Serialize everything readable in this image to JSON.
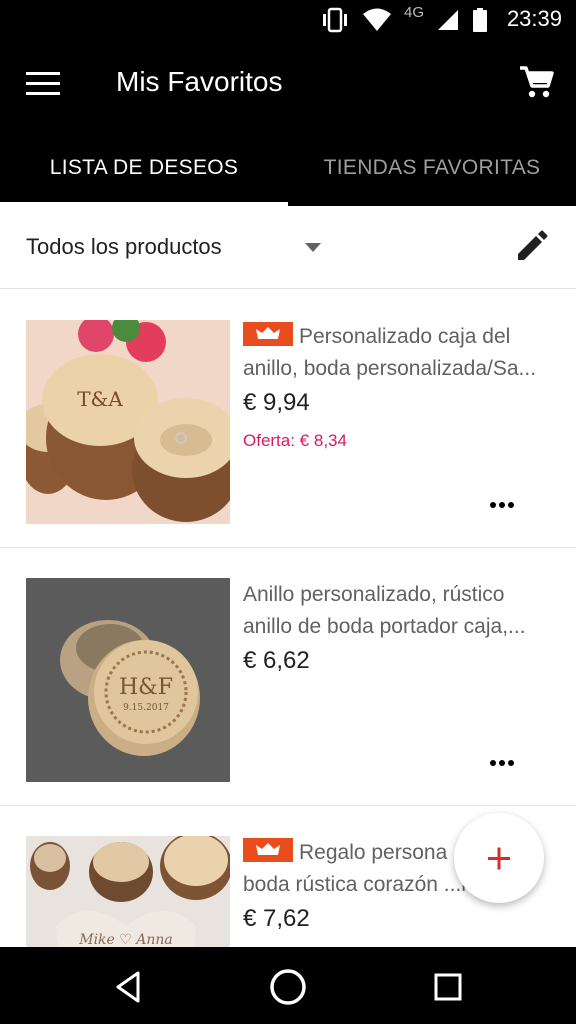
{
  "status_bar": {
    "network": "4G",
    "time": "23:39"
  },
  "app_bar": {
    "title": "Mis Favoritos"
  },
  "tabs": [
    {
      "label": "LISTA DE DESEOS",
      "active": true
    },
    {
      "label": "TIENDAS FAVORITAS",
      "active": false
    }
  ],
  "filter": {
    "selected": "Todos los productos"
  },
  "products": [
    {
      "title_line1": "Personalizado caja del",
      "title_line2": "anillo, boda personalizada/Sa...",
      "price": "€ 9,94",
      "offer": "Oferta: € 8,34",
      "has_badge": true,
      "image": "wooden-log-ring-boxes"
    },
    {
      "title_line1": "Anillo personalizado, rústico",
      "title_line2": "anillo de boda portador caja,...",
      "price": "€ 6,62",
      "offer": "",
      "has_badge": false,
      "image": "round-wooden-ring-box"
    },
    {
      "title_line1": "Regalo persona",
      "title_line2": "boda rústica corazón ...n...",
      "price": "€ 7,62",
      "offer": "",
      "has_badge": true,
      "image": "heart-wood-slices"
    }
  ],
  "fab": {
    "icon": "plus-icon"
  },
  "colors": {
    "bar": "#000000",
    "badge": "#e94d1e",
    "offer": "#d81b60",
    "fab_plus": "#d32f2f"
  }
}
